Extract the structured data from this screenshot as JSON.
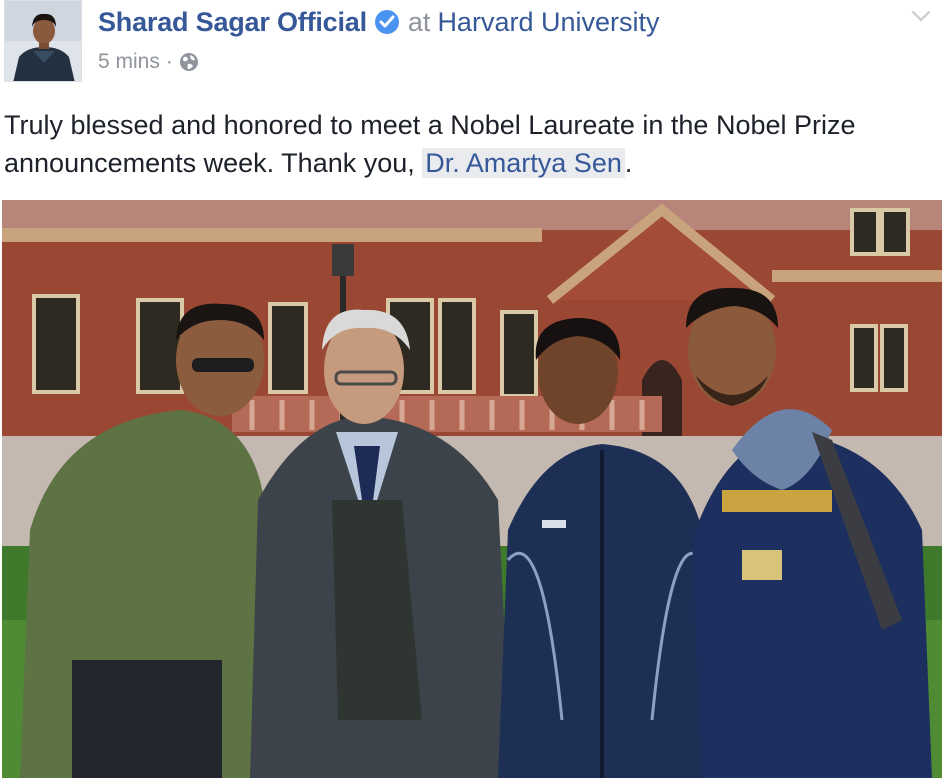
{
  "header": {
    "author": "Sharad Sagar Official",
    "at_word": "at",
    "location": "Harvard University",
    "timestamp": "5 mins",
    "separator": "·",
    "privacy_icon": "globe-icon",
    "verified_icon": "verified-badge-icon",
    "menu_icon": "chevron-down-icon"
  },
  "post": {
    "text_before": "Truly blessed and honored to meet a Nobel Laureate in the Nobel Prize announcements week. Thank you, ",
    "mention": "Dr. Amartya Sen",
    "text_after": "."
  },
  "colors": {
    "link": "#365899",
    "meta": "#90949c",
    "verified": "#4b93f0",
    "mention_bg": "#e9ebee"
  }
}
